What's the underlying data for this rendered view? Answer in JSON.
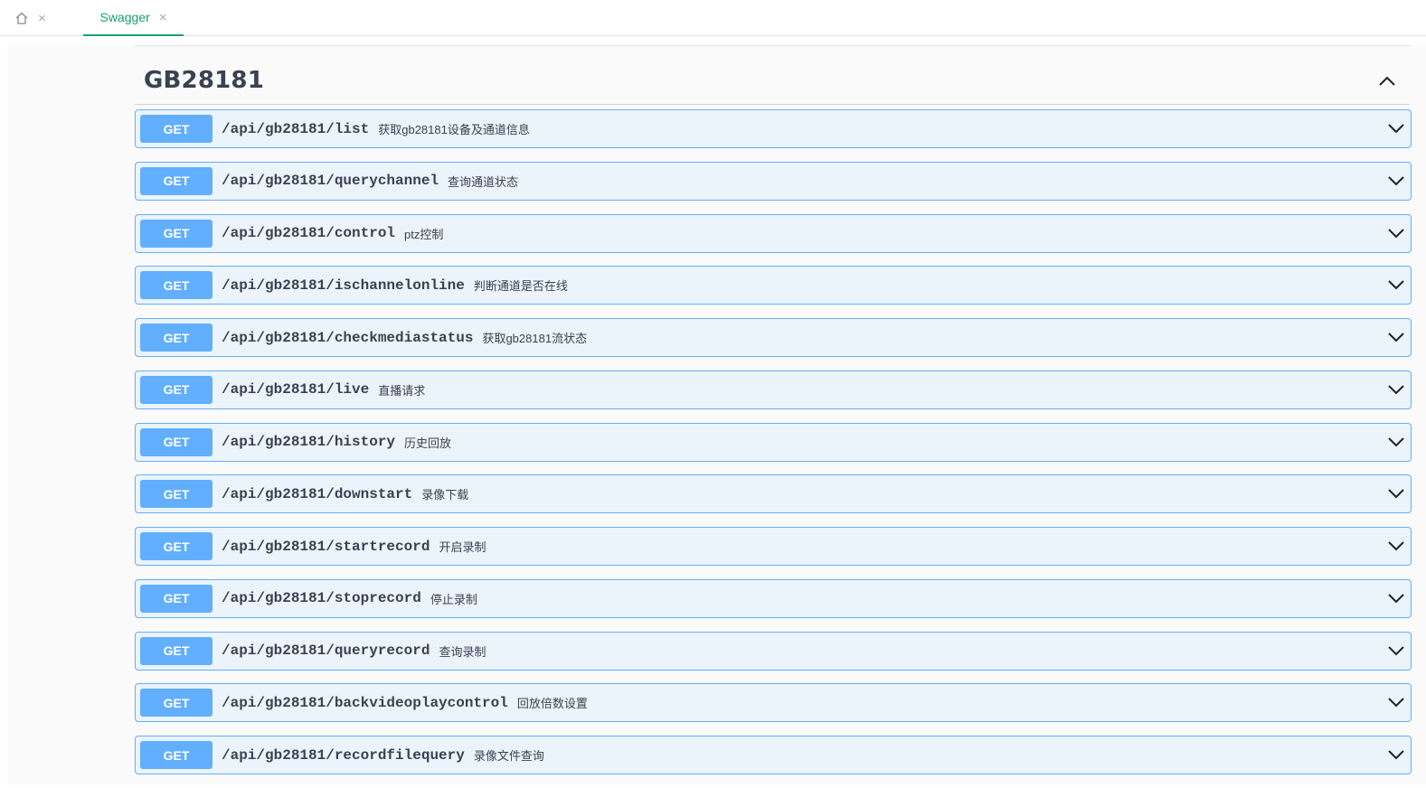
{
  "tabs": [
    {
      "icon": "home-icon",
      "close": "×"
    },
    {
      "label": "Swagger",
      "close": "×",
      "active": true
    }
  ],
  "colors": {
    "accent_tab": "#1aa16c",
    "get_method": "#61affe",
    "get_row_bg": "#ebf3fb",
    "text": "#3b4151"
  },
  "section": {
    "title": "GB28181",
    "toggle_icon": "chevron-up-icon"
  },
  "operations": [
    {
      "method": "GET",
      "path": "/api/gb28181/list",
      "summary": "获取gb28181设备及通道信息"
    },
    {
      "method": "GET",
      "path": "/api/gb28181/querychannel",
      "summary": "查询通道状态"
    },
    {
      "method": "GET",
      "path": "/api/gb28181/control",
      "summary": "ptz控制"
    },
    {
      "method": "GET",
      "path": "/api/gb28181/ischannelonline",
      "summary": "判断通道是否在线"
    },
    {
      "method": "GET",
      "path": "/api/gb28181/checkmediastatus",
      "summary": "获取gb28181流状态"
    },
    {
      "method": "GET",
      "path": "/api/gb28181/live",
      "summary": "直播请求"
    },
    {
      "method": "GET",
      "path": "/api/gb28181/history",
      "summary": "历史回放"
    },
    {
      "method": "GET",
      "path": "/api/gb28181/downstart",
      "summary": "录像下载"
    },
    {
      "method": "GET",
      "path": "/api/gb28181/startrecord",
      "summary": "开启录制"
    },
    {
      "method": "GET",
      "path": "/api/gb28181/stoprecord",
      "summary": "停止录制"
    },
    {
      "method": "GET",
      "path": "/api/gb28181/queryrecord",
      "summary": "查询录制"
    },
    {
      "method": "GET",
      "path": "/api/gb28181/backvideoplaycontrol",
      "summary": "回放倍数设置"
    },
    {
      "method": "GET",
      "path": "/api/gb28181/recordfilequery",
      "summary": "录像文件查询"
    }
  ]
}
